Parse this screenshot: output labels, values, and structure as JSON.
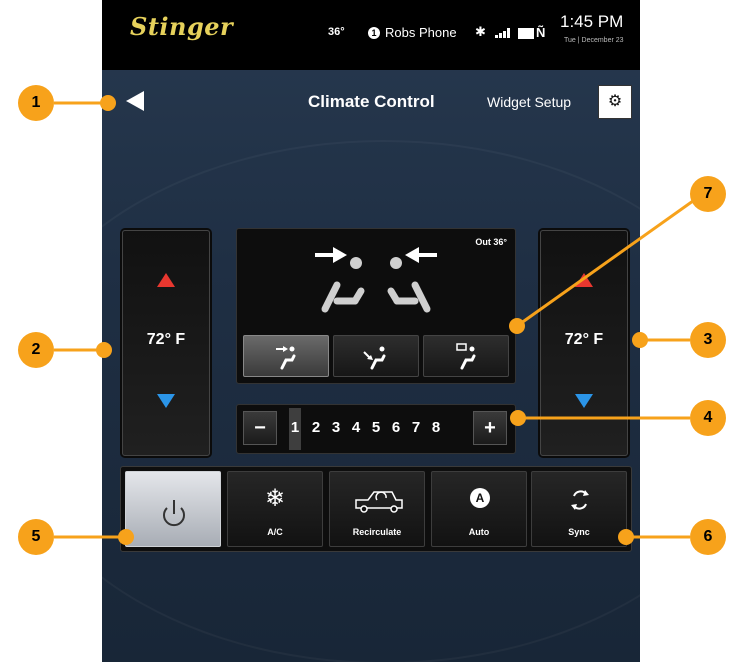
{
  "status_bar": {
    "brand": "Stinger",
    "outside_temp": "36°",
    "phone_badge": "1",
    "phone_name": "Robs Phone",
    "time": "1:45 PM",
    "date": "Tue | December 23",
    "icons": [
      "bluetooth-icon",
      "signal-icon",
      "battery-icon",
      "network-n-icon"
    ]
  },
  "header": {
    "title": "Climate Control",
    "widget_setup": "Widget Setup",
    "back_icon": "back-arrow-icon",
    "settings_icon": "gear-icon"
  },
  "driver_temp": {
    "value": "72° F"
  },
  "passenger_temp": {
    "value": "72° F"
  },
  "seat_display": {
    "out_label": "Out 36°",
    "modes": [
      "face-vent-icon",
      "floor-vent-icon",
      "defrost-vent-icon"
    ],
    "selected_mode": 0
  },
  "fan": {
    "minus": "−",
    "plus": "+",
    "levels": [
      "1",
      "2",
      "3",
      "4",
      "5",
      "6",
      "7",
      "8"
    ],
    "selected_level": 1
  },
  "functions": {
    "power_icon": "power-icon",
    "ac": {
      "label": "A/C",
      "icon": "snowflake-icon"
    },
    "recirculate": {
      "label": "Recirculate",
      "icon": "recirculate-car-icon"
    },
    "auto": {
      "label": "Auto",
      "icon_text": "A"
    },
    "sync": {
      "label": "Sync",
      "icon": "sync-icon"
    }
  },
  "callouts": [
    "1",
    "2",
    "3",
    "4",
    "5",
    "6",
    "7"
  ],
  "colors": {
    "accent": "#f7a21b",
    "temp_up": "#e8372f",
    "temp_down": "#2b95e8",
    "brand": "#e6d15b"
  }
}
